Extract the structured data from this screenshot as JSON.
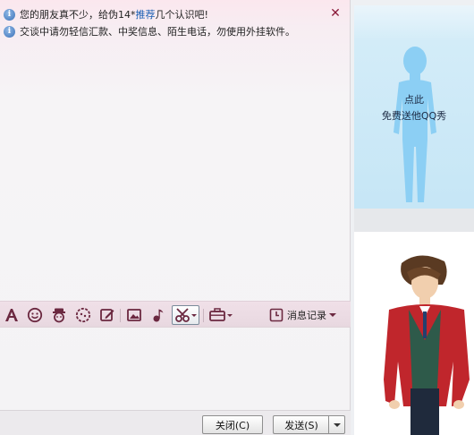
{
  "notices": {
    "n1_prefix": "您的朋友真不少，给伪14*",
    "n1_link": "推荐",
    "n1_suffix": "几个认识吧!",
    "n2": "交谈中请勿轻信汇款、中奖信息、陌生电话，勿使用外挂软件。"
  },
  "icons": {
    "close": "close-icon",
    "info": "info-icon",
    "font": "font-icon",
    "emoji": "smiley-icon",
    "magic": "magic-face-icon",
    "doodle": "doodle-icon",
    "edit": "edit-icon",
    "image": "image-icon",
    "music": "music-icon",
    "scissors": "screenshot-scissors-icon",
    "briefcase": "app-box-icon",
    "history": "history-icon",
    "avatar": "avatar-silhouette-icon",
    "character": "show-character"
  },
  "toolbar": {
    "history_label": "消息记录"
  },
  "buttons": {
    "close_label": "关闭(C)",
    "send_label": "发送(S)"
  },
  "promo": {
    "line1": "点此",
    "line2": "免费送他QQ秀"
  },
  "colors": {
    "accent": "#6b2840",
    "link": "#1a5fb4",
    "sky": "#c6e6f6",
    "silhouette": "#8ccff4"
  }
}
